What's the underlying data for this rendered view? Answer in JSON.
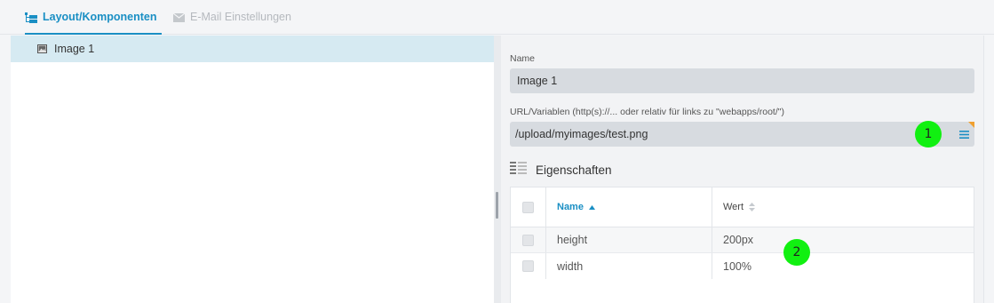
{
  "tabs": [
    {
      "label": "Layout/Komponenten",
      "active": true
    },
    {
      "label": "E-Mail Einstellungen",
      "active": false
    }
  ],
  "tree": {
    "items": [
      {
        "label": "Image 1",
        "icon": "image-icon",
        "selected": true
      }
    ]
  },
  "form": {
    "name_label": "Name",
    "name_value": "Image 1",
    "url_label": "URL/Variablen (http(s)://... oder relativ für links zu \"webapps/root/\")",
    "url_value": "/upload/myimages/test.png"
  },
  "properties": {
    "title": "Eigenschaften",
    "columns": {
      "name": "Name",
      "value": "Wert"
    },
    "rows": [
      {
        "name": "height",
        "value": "200px"
      },
      {
        "name": "width",
        "value": "100%"
      }
    ]
  },
  "markers": [
    "1",
    "2"
  ],
  "colors": {
    "accent": "#1a8fc4",
    "selection": "#d6eaf2",
    "marker": "#11f011",
    "corner": "#f0a030"
  }
}
